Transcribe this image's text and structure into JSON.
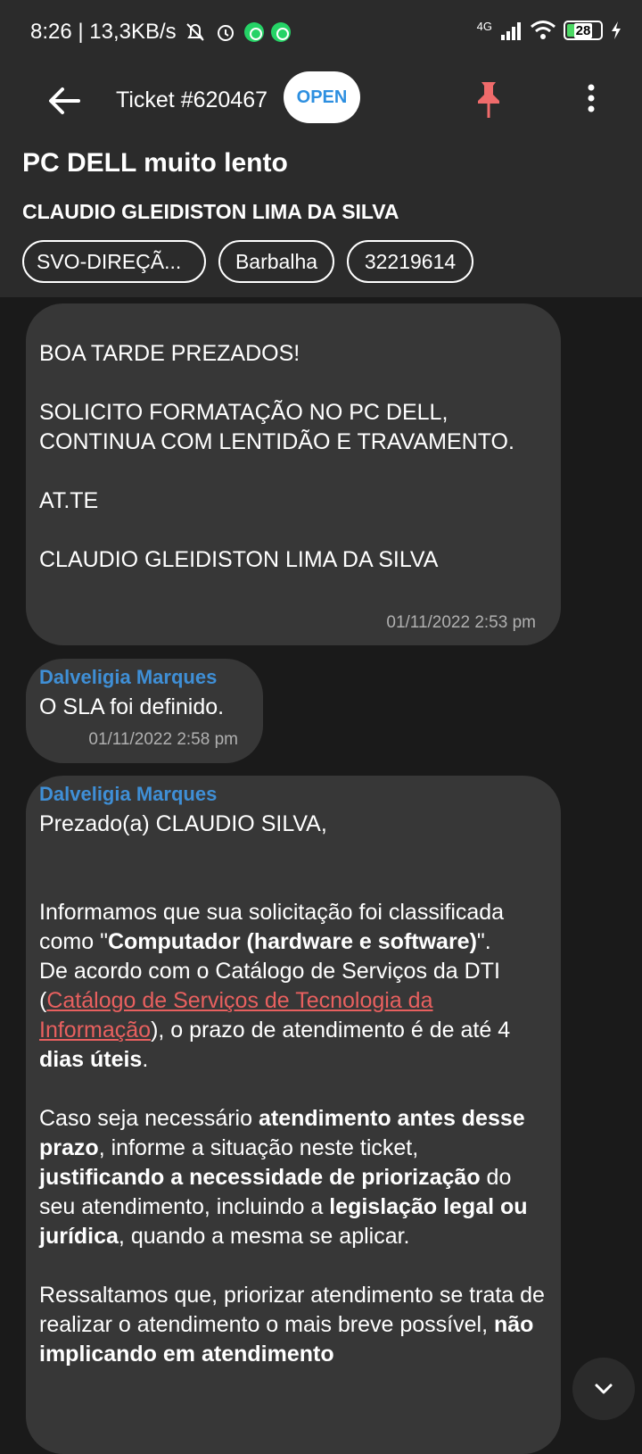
{
  "status_bar": {
    "time_speed": "8:26 | 13,3KB/s",
    "network": "4G",
    "battery": "28"
  },
  "header": {
    "ticket_title": "Ticket #620467",
    "status_badge": "OPEN",
    "subject": "PC DELL muito lento",
    "requester": "CLAUDIO GLEIDISTON LIMA DA SILVA",
    "chips": [
      "SVO-DIREÇÃ...",
      "Barbalha",
      "32219614"
    ],
    "pin_color": "#f06b6b",
    "badge_text_color": "#2d8fe0"
  },
  "messages": [
    {
      "text": "BOA TARDE PREZADOS!\n\nSOLICITO FORMATAÇÃO NO PC DELL, CONTINUA COM LENTIDÃO E TRAVAMENTO.\n\nAT.TE\n\nCLAUDIO GLEIDISTON LIMA DA SILVA",
      "timestamp": "01/11/2022 2:53 pm"
    },
    {
      "author": "Dalveligia Marques",
      "text": "O SLA foi definido.",
      "timestamp": "01/11/2022 2:58 pm"
    },
    {
      "author": "Dalveligia Marques",
      "greeting": "Prezado(a) CLAUDIO SILVA,",
      "p1_a": "Informamos que sua solicitação foi classificada como \"",
      "p1_b": "Computador (hardware e software)",
      "p1_c": "\".",
      "p2_a": "De acordo com o Catálogo de Serviços da DTI (",
      "p2_link": "Catálogo de Serviços de Tecnologia da Informação",
      "p2_b": "), o prazo de atendimento é de até 4 ",
      "p2_c": "dias úteis",
      "p2_d": ".",
      "p3_a": "Caso seja necessário ",
      "p3_b": "atendimento antes desse prazo",
      "p3_c": ", informe a situação neste ticket, ",
      "p3_d": "justificando a necessidade de priorização",
      "p3_e": " do seu atendimento, incluindo a ",
      "p3_f": "legislação legal ou jurídica",
      "p3_g": ", quando a mesma se aplicar.",
      "p4_a": "Ressaltamos que, priorizar atendimento se trata de realizar o atendimento o mais breve possível, ",
      "p4_b": "não implicando em atendimento"
    }
  ],
  "colors": {
    "author": "#3f8fd6",
    "link": "#e8605f",
    "bubble": "#373737",
    "background": "#1a1a1a",
    "header": "#2b2b2b"
  }
}
